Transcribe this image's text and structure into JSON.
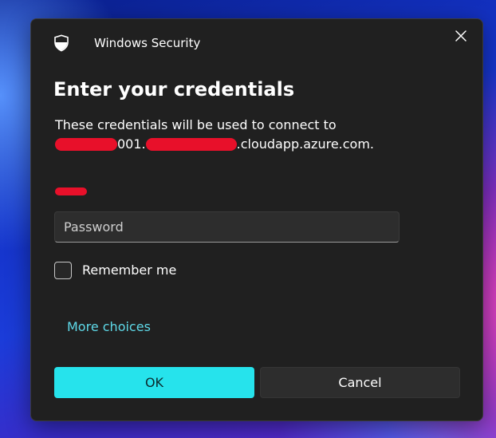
{
  "window": {
    "app_title": "Windows Security",
    "close_icon": "close-icon",
    "app_icon": "shield-icon"
  },
  "dialog": {
    "heading": "Enter your credentials",
    "description": "These credentials will be used to connect to",
    "host_mid": "001.",
    "host_suffix": ".cloudapp.azure.com."
  },
  "password": {
    "placeholder": "Password",
    "value": ""
  },
  "remember": {
    "label": "Remember me",
    "checked": false
  },
  "more_choices": {
    "label": "More choices"
  },
  "buttons": {
    "ok_label": "OK",
    "cancel_label": "Cancel"
  },
  "colors": {
    "accent": "#26e3ec",
    "link": "#5ed9e8",
    "dialog_bg": "#202020",
    "redaction": "#e8102a"
  }
}
